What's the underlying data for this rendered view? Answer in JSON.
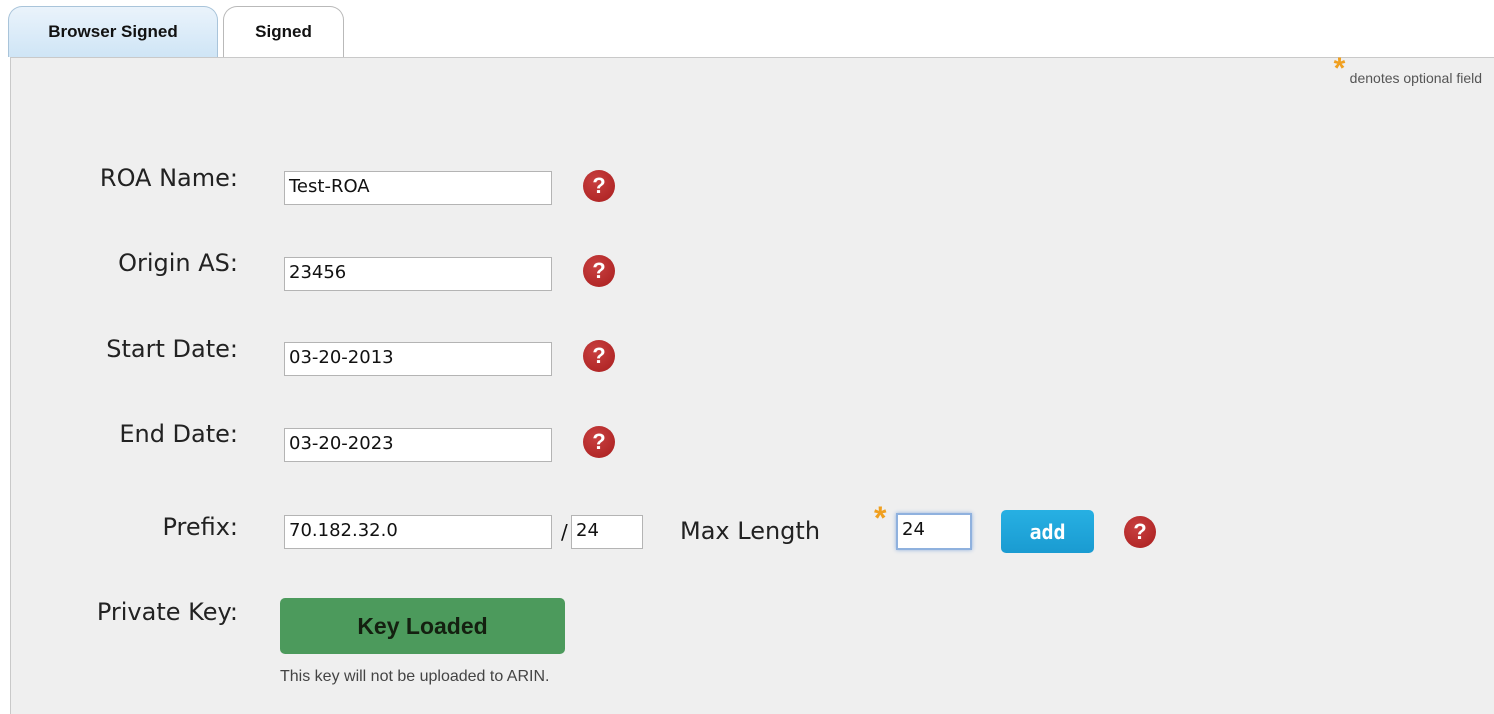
{
  "tabs": [
    {
      "label": "Browser Signed",
      "active": true
    },
    {
      "label": "Signed",
      "active": false
    }
  ],
  "optional_note": {
    "star": "*",
    "text": "denotes optional field"
  },
  "form": {
    "roa_name": {
      "label": "ROA Name:",
      "value": "Test-ROA"
    },
    "origin_as": {
      "label": "Origin AS:",
      "value": "23456"
    },
    "start_date": {
      "label": "Start Date:",
      "value": "03-20-2013"
    },
    "end_date": {
      "label": "End Date:",
      "value": "03-20-2023"
    },
    "prefix": {
      "label": "Prefix:",
      "address": "70.182.32.0",
      "separator": "/",
      "length": "24",
      "max_length_label": "Max Length",
      "max_length_star": "*",
      "max_length_value": "24",
      "add_label": "add"
    },
    "private_key": {
      "label": "Private Key:",
      "button_label": "Key Loaded",
      "note": "This key will not be uploaded to ARIN."
    }
  },
  "help_glyph": "?",
  "colors": {
    "help_icon": "#b02525",
    "add_button": "#1fa4d9",
    "key_button": "#4c9a5c",
    "optional_star": "#f0a020",
    "active_tab": "#d6e9f8"
  }
}
